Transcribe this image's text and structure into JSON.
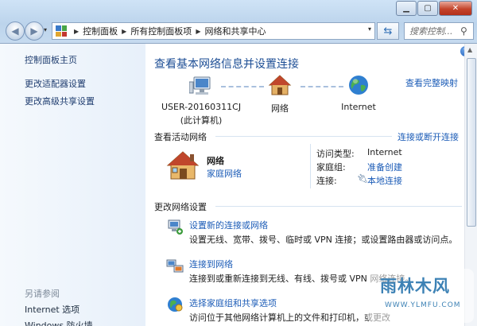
{
  "nav": {
    "breadcrumbs": [
      "控制面板",
      "所有控制面板项",
      "网络和共享中心"
    ],
    "search_placeholder": "搜索控制..."
  },
  "sidebar": {
    "links": [
      "控制面板主页",
      "更改适配器设置",
      "更改高级共享设置"
    ],
    "see_also_header": "另请参阅",
    "see_also": [
      "Internet 选项",
      "Windows 防火墙"
    ]
  },
  "main": {
    "title": "查看基本网络信息并设置连接",
    "full_map_link": "查看完整映射",
    "map": {
      "computer_line1": "USER-20160311CJ",
      "computer_line2": "(此计算机)",
      "network": "网络",
      "internet": "Internet"
    },
    "active": {
      "header": "查看活动网络",
      "connect_link": "连接或断开连接",
      "network_name": "网络",
      "network_type": "家庭网络",
      "access_type_label": "访问类型:",
      "access_type_value": "Internet",
      "homegroup_label": "家庭组:",
      "homegroup_value": "准备创建",
      "connection_label": "连接:",
      "connection_value": "本地连接"
    },
    "change": {
      "header": "更改网络设置",
      "tasks": [
        {
          "title": "设置新的连接或网络",
          "desc": "设置无线、宽带、拨号、临时或 VPN 连接；或设置路由器或访问点。"
        },
        {
          "title": "连接到网络",
          "desc": "连接到或重新连接到无线、有线、拨号或 VPN 网络连接。"
        },
        {
          "title": "选择家庭组和共享选项",
          "desc": "访问位于其他网络计算机上的文件和打印机，或更改"
        }
      ]
    }
  },
  "watermark": {
    "text": "雨林木风",
    "url": "WWW.YLMFU.COM"
  },
  "colors": {
    "link": "#1c5cb7",
    "title": "#1d4e95",
    "sidebar_link": "#1f3d6f"
  },
  "icons": [
    "back-arrow-icon",
    "forward-arrow-icon",
    "control-panel-icon",
    "refresh-icon",
    "search-icon",
    "help-icon",
    "computer-icon",
    "house-icon",
    "globe-icon",
    "network-cable-icon",
    "connect-icon",
    "homegroup-icon"
  ]
}
